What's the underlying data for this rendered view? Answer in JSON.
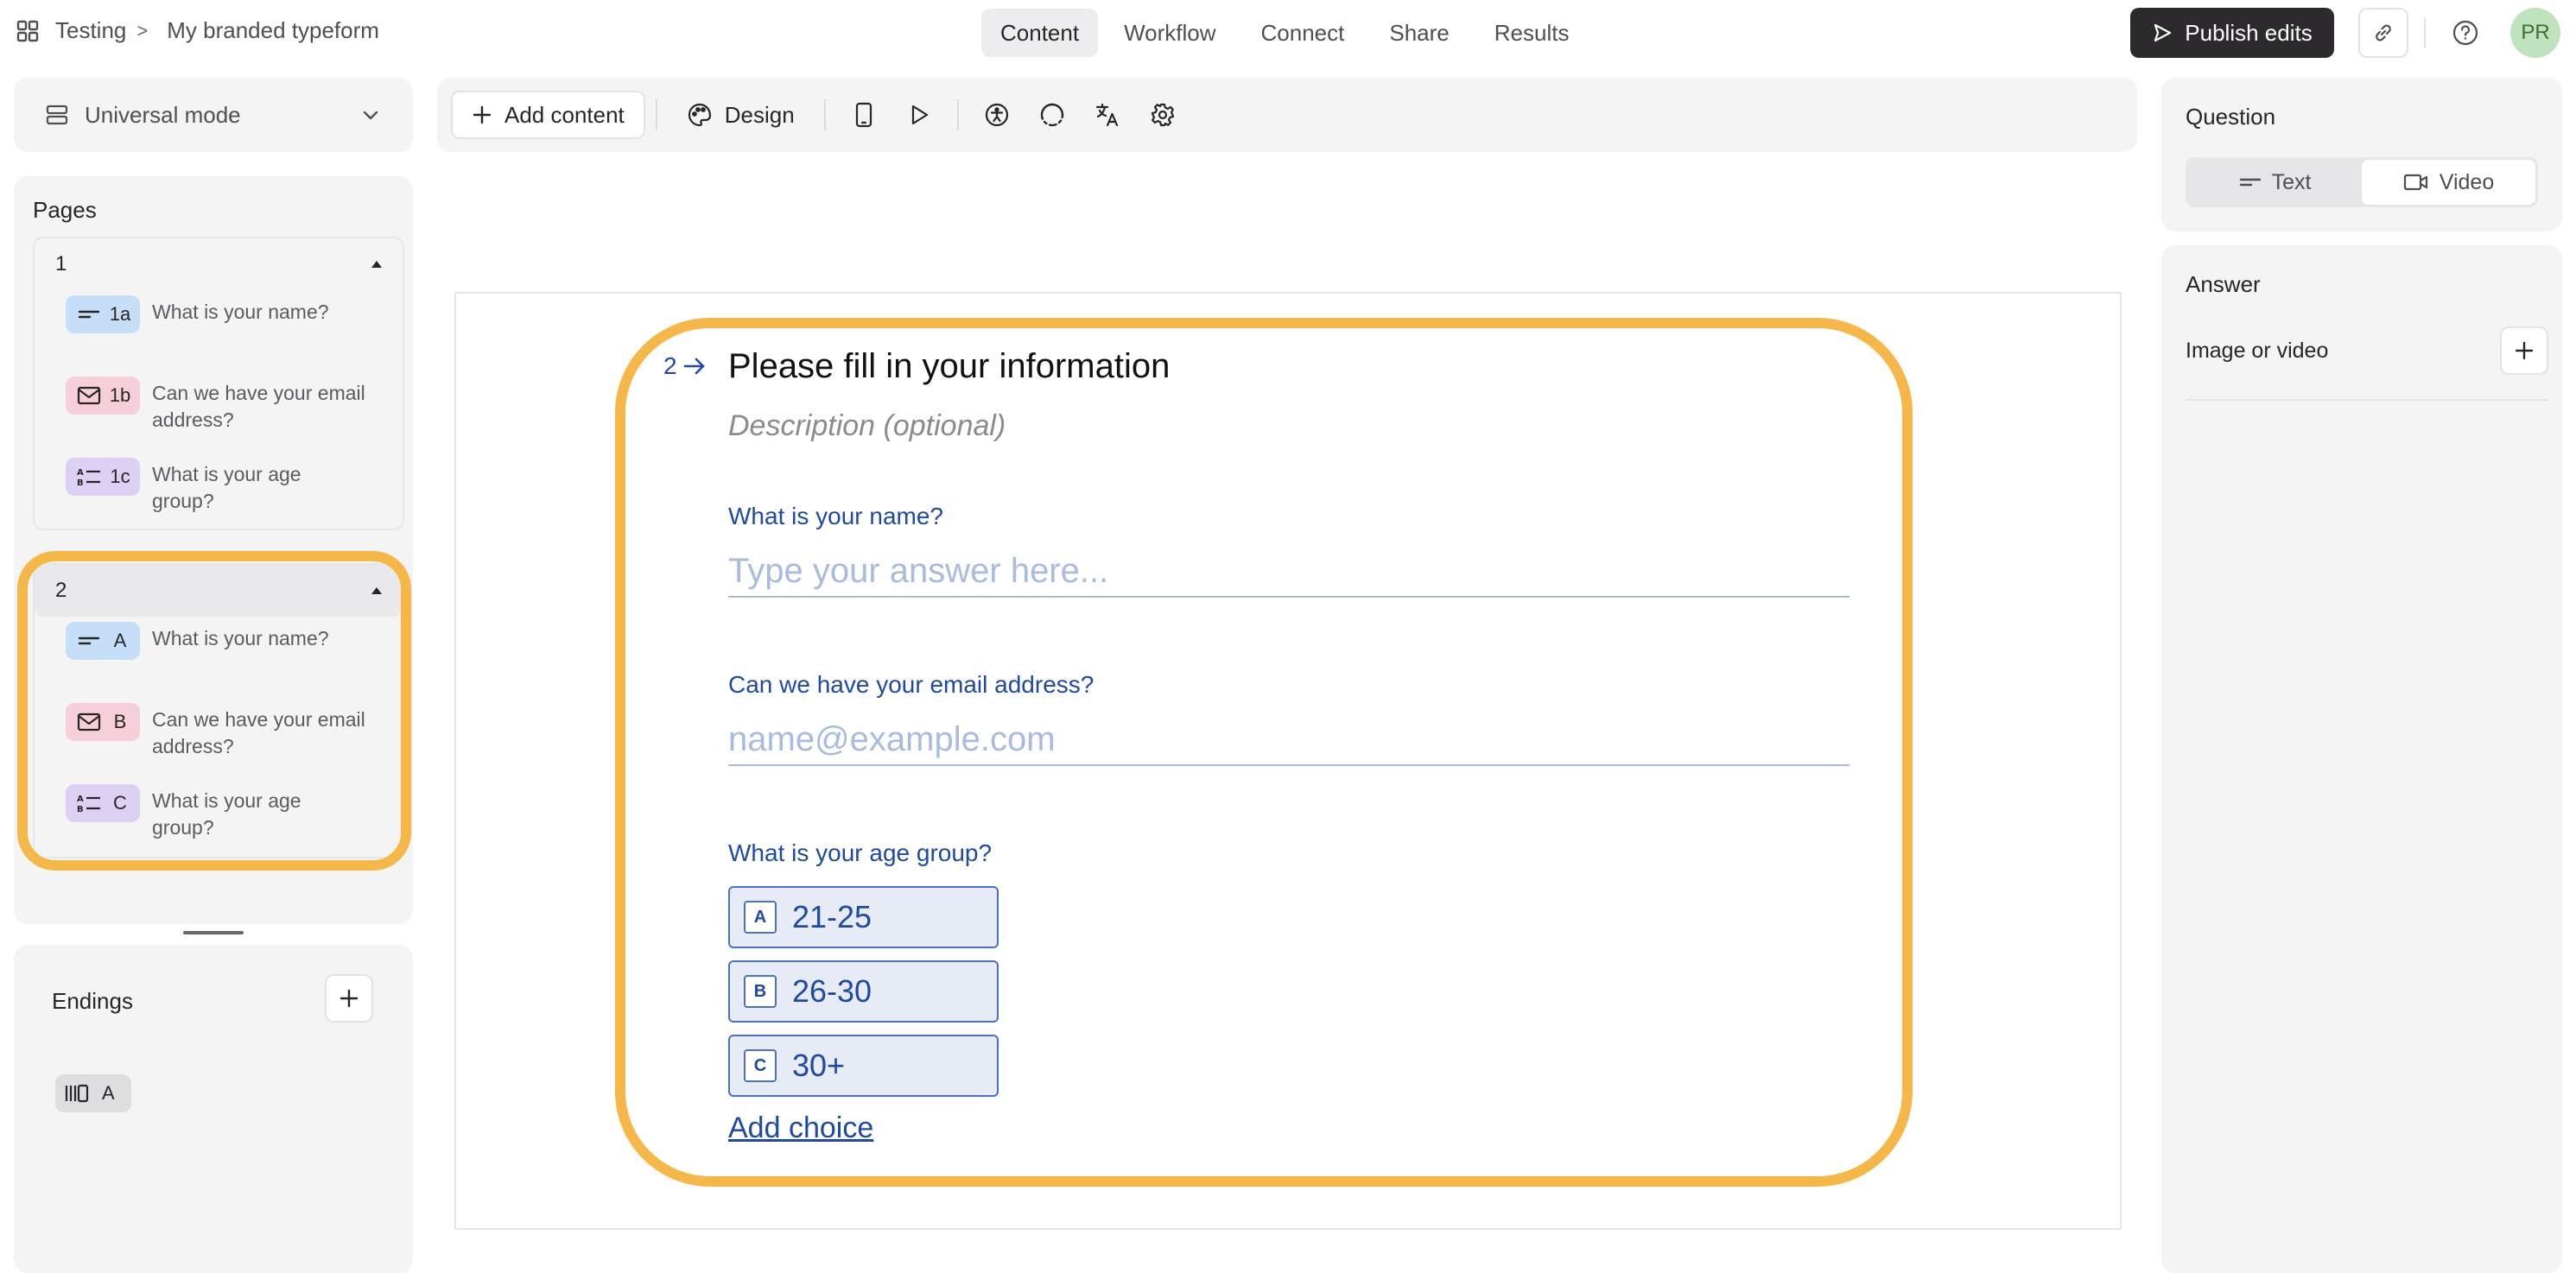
{
  "header": {
    "workspace": "Testing",
    "separator": ">",
    "form_name": "My branded typeform",
    "tabs": [
      {
        "label": "Content",
        "active": true
      },
      {
        "label": "Workflow",
        "active": false
      },
      {
        "label": "Connect",
        "active": false
      },
      {
        "label": "Share",
        "active": false
      },
      {
        "label": "Results",
        "active": false
      }
    ],
    "publish_label": "Publish edits",
    "avatar_initials": "PR"
  },
  "sidebar": {
    "mode_label": "Universal mode",
    "pages_title": "Pages",
    "groups": [
      {
        "number": "1",
        "items": [
          {
            "code": "1a",
            "type": "short-text",
            "label": "What is your name?"
          },
          {
            "code": "1b",
            "type": "email",
            "label": "Can we have your email address?"
          },
          {
            "code": "1c",
            "type": "multiple-choice",
            "label": "What is your age group?"
          }
        ]
      },
      {
        "number": "2",
        "items": [
          {
            "code": "A",
            "type": "short-text",
            "label": "What is your name?"
          },
          {
            "code": "B",
            "type": "email",
            "label": "Can we have your email address?"
          },
          {
            "code": "C",
            "type": "multiple-choice",
            "label": "What is your age group?"
          }
        ]
      }
    ],
    "endings_title": "Endings",
    "endings": [
      {
        "code": "A"
      }
    ]
  },
  "toolbar": {
    "add_content_label": "Add content",
    "design_label": "Design"
  },
  "question": {
    "number": "2",
    "title": "Please fill in your information",
    "description_placeholder": "Description (optional)",
    "fields": [
      {
        "label": "What is your name?",
        "placeholder": "Type your answer here..."
      },
      {
        "label": "Can we have your email address?",
        "placeholder": "name@example.com"
      }
    ],
    "choice_label": "What is your age group?",
    "choices": [
      {
        "key": "A",
        "text": "21-25"
      },
      {
        "key": "B",
        "text": "26-30"
      },
      {
        "key": "C",
        "text": "30+"
      }
    ],
    "add_choice_label": "Add choice"
  },
  "right_panel": {
    "question_title": "Question",
    "segments": [
      "Text",
      "Video"
    ],
    "answer_title": "Answer",
    "image_or_video_label": "Image or video"
  },
  "colors": {
    "accent_blue": "#1e4aa3",
    "highlight": "#f5b848",
    "publish_bg": "#2d2a2e"
  }
}
